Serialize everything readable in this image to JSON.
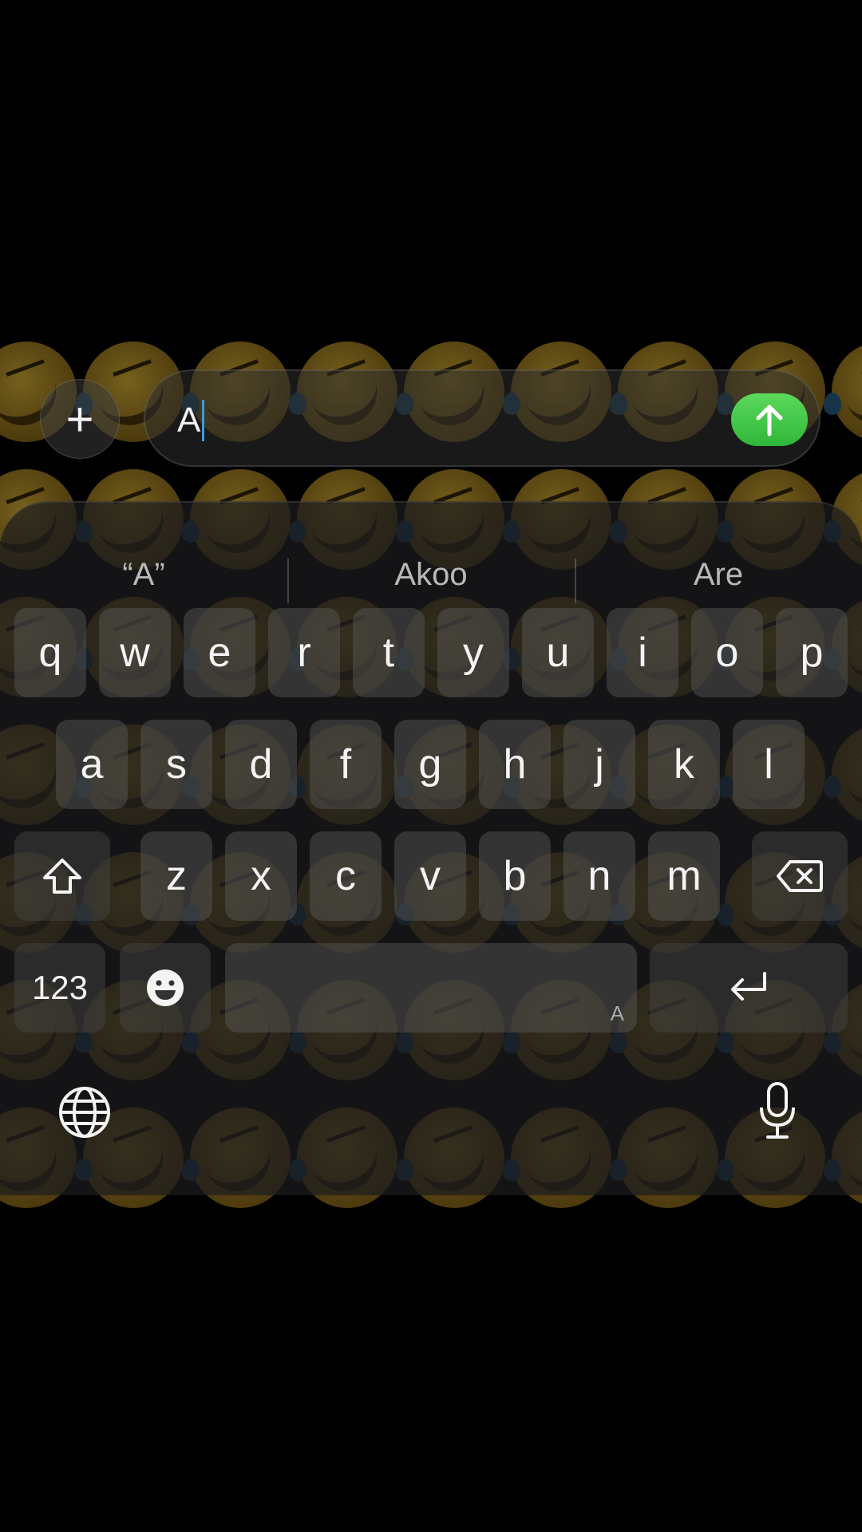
{
  "input": {
    "text": "A",
    "plus_label": "+",
    "send_icon": "arrow-up-icon",
    "send_color": "#3cc745"
  },
  "suggestions": [
    "“A”",
    "Akoo",
    "Are"
  ],
  "keyboard": {
    "row1": [
      "q",
      "w",
      "e",
      "r",
      "t",
      "y",
      "u",
      "i",
      "o",
      "p"
    ],
    "row2": [
      "a",
      "s",
      "d",
      "f",
      "g",
      "h",
      "j",
      "k",
      "l"
    ],
    "row3": [
      "z",
      "x",
      "c",
      "v",
      "b",
      "n",
      "m"
    ],
    "numbers_label": "123",
    "space_hint": "A",
    "icons": {
      "shift": "shift-icon",
      "backspace": "backspace-icon",
      "emoji": "emoji-icon",
      "enter": "enter-icon",
      "globe": "globe-icon",
      "mic": "mic-icon"
    }
  }
}
